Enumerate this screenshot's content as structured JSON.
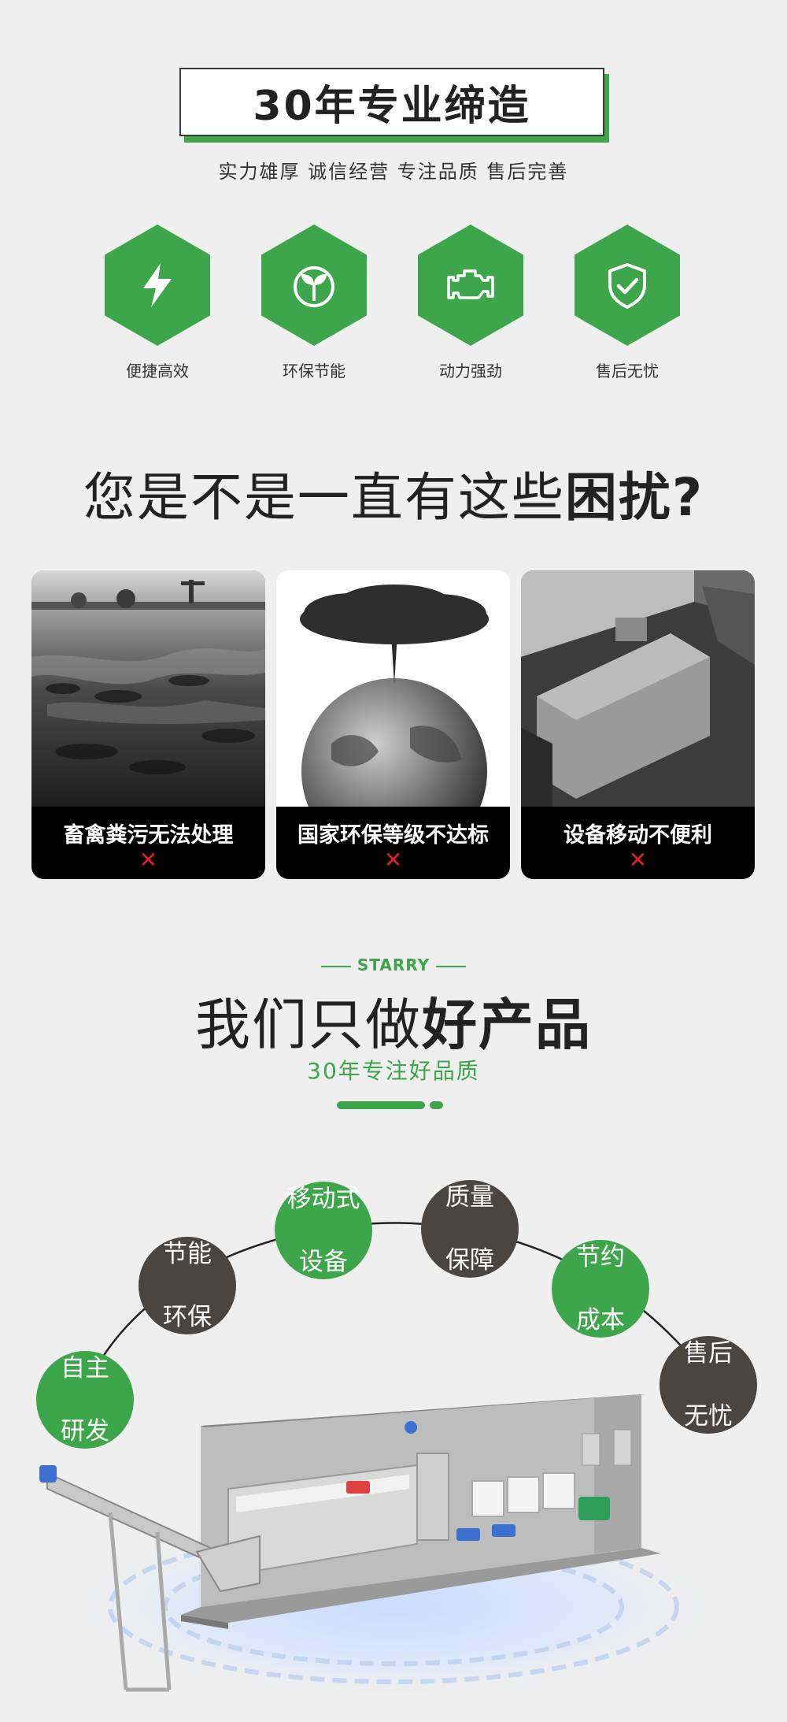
{
  "header": {
    "title": "30年专业缔造",
    "subtitle": "实力雄厚 诚信经营 专注品质 售后完善"
  },
  "features": [
    {
      "label": "便捷高效",
      "icon": "lightning-icon"
    },
    {
      "label": "环保节能",
      "icon": "eco-leaf-icon"
    },
    {
      "label": "动力强劲",
      "icon": "engine-icon"
    },
    {
      "label": "售后无忧",
      "icon": "shield-check-icon"
    }
  ],
  "problems": {
    "title_normal": "您是不是一直有这些",
    "title_bold": "困扰?",
    "cards": [
      {
        "label": "畜禽粪污无法处理",
        "mark": "✕"
      },
      {
        "label": "国家环保等级不达标",
        "mark": "✕"
      },
      {
        "label": "设备移动不便利",
        "mark": "✕"
      }
    ]
  },
  "product": {
    "brand": "STARRY",
    "title_normal": "我们只做",
    "title_bold": "好产品",
    "subtitle": "30年专注好品质",
    "circles": [
      {
        "line1": "自主",
        "line2": "研发",
        "color": "green"
      },
      {
        "line1": "节能",
        "line2": "环保",
        "color": "dark"
      },
      {
        "line1": "移动式",
        "line2": "设备",
        "color": "green"
      },
      {
        "line1": "质量",
        "line2": "保障",
        "color": "dark"
      },
      {
        "line1": "节约",
        "line2": "成本",
        "color": "green"
      },
      {
        "line1": "售后",
        "line2": "无忧",
        "color": "dark"
      }
    ]
  },
  "colors": {
    "accent": "#3ea64a",
    "dark": "#4a4540",
    "cross": "#e02020",
    "background": "#efefef"
  }
}
